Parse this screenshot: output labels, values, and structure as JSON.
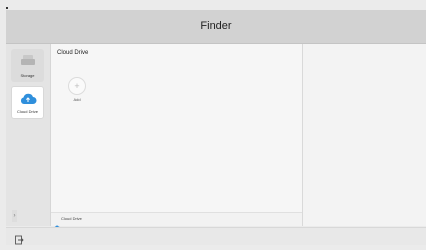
{
  "window": {
    "title": "Finder"
  },
  "sidebar": {
    "items": [
      {
        "label": "Storage",
        "icon": "storage-icon",
        "selected": false
      },
      {
        "label": "Cloud Drive",
        "icon": "cloud-upload-icon",
        "selected": true
      }
    ]
  },
  "main": {
    "heading": "Cloud Drive",
    "tiles": [
      {
        "label": "Add",
        "icon": "plus-icon"
      }
    ],
    "breadcrumb": {
      "text": "Cloud Drive",
      "icon": "cloud-icon"
    }
  },
  "bottombar": {
    "exit_icon": "exit-icon"
  },
  "colors": {
    "accent": "#2f8fdc",
    "titlebar": "#d2d2d2"
  }
}
